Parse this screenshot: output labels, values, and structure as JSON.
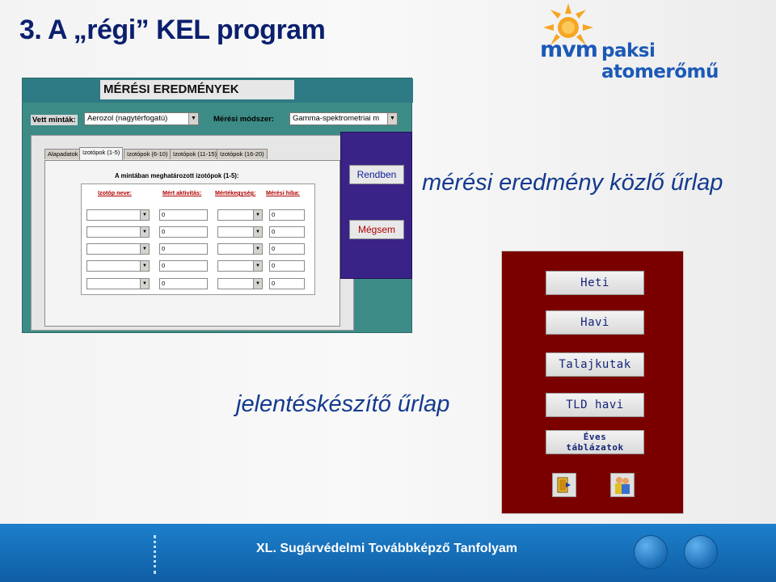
{
  "slide": {
    "title": "3. A „régi” KEL program",
    "logo_mvm": "mvm",
    "logo_name": "paksi atomerőmű",
    "footer": "XL. Sugárvédelmi Továbbképző Tanfolyam",
    "colors": {
      "title": "#0b1f6e",
      "caption": "#143a8e",
      "footer": "#1670bb"
    }
  },
  "measure_form": {
    "title": "MÉRÉSI EREDMÉNYEK",
    "samples_label": "Vett minták:",
    "samples_value": "Aerozol (nagytérfogatú)",
    "method_label": "Mérési módszer:",
    "method_value": "Gamma-spektrometriai m",
    "tabs": [
      "Alapadatok",
      "Izotópok (1-5)",
      "Izotópok (6-10)",
      "Izotópok (11-15)",
      "Izotópok (16-20)"
    ],
    "active_tab": "Izotópok (1-5)",
    "panel_heading": "A mintában meghatározott izotópok (1-5):",
    "columns": [
      "Izotóp neve:",
      "Mért aktivitás:",
      "Mértékegység:",
      "Mérési hiba:"
    ],
    "rows": [
      {
        "activity": "0",
        "error": "0"
      },
      {
        "activity": "0",
        "error": "0"
      },
      {
        "activity": "0",
        "error": "0"
      },
      {
        "activity": "0",
        "error": "0"
      },
      {
        "activity": "0",
        "error": "0"
      }
    ],
    "ok_button": "Rendben",
    "cancel_button": "Mégsem"
  },
  "captions": {
    "measure": "mérési eredmény közlő űrlap",
    "report": "jelentéskészítő űrlap"
  },
  "report_form": {
    "buttons": [
      "Heti",
      "Havi",
      "Talajkutak",
      "TLD havi"
    ],
    "yearly_line1": "Éves",
    "yearly_line2": "táblázatok",
    "icons": [
      "exit-icon",
      "users-icon"
    ]
  }
}
